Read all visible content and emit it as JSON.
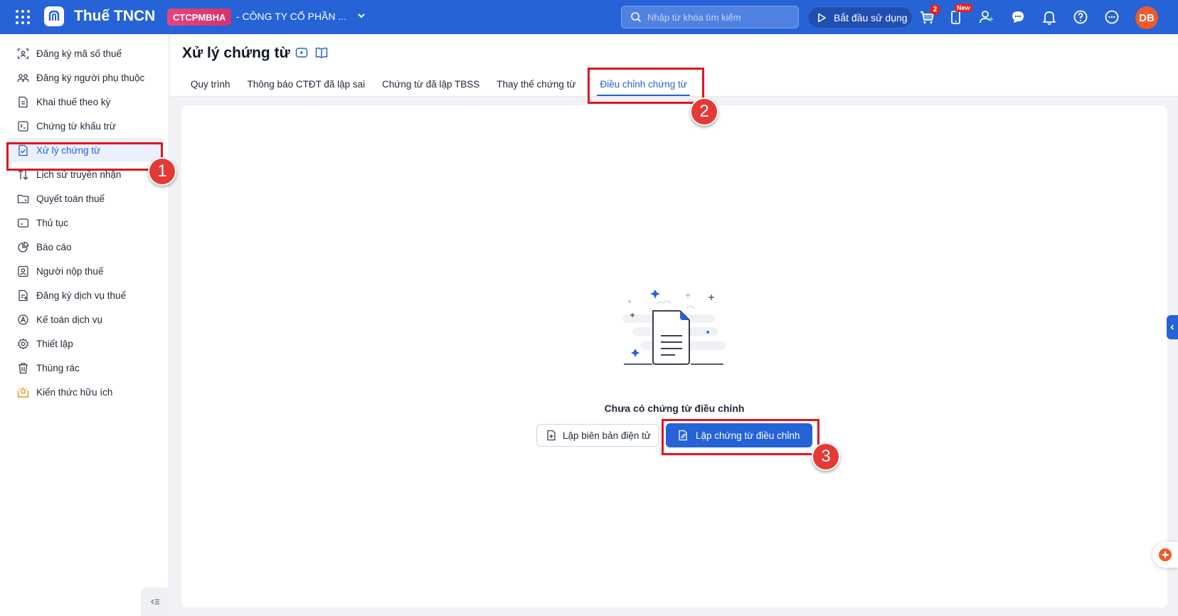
{
  "app": {
    "title": "Thuế TNCN"
  },
  "company": {
    "code": "CTCPMBHA",
    "name": "- CÔNG TY CỔ PHẦN ..."
  },
  "search": {
    "placeholder": "Nhập từ khóa tìm kiếm"
  },
  "header": {
    "start_label": "Bắt đầu sử dụng",
    "cart_badge": "2",
    "new_badge": "New",
    "avatar_initials": "DB"
  },
  "sidebar": {
    "items": [
      {
        "label": "Đăng ký mã số thuế",
        "icon": "id-card-icon"
      },
      {
        "label": "Đăng ký người phụ thuộc",
        "icon": "people-icon"
      },
      {
        "label": "Khai thuế theo kỳ",
        "icon": "document-icon"
      },
      {
        "label": "Chứng từ khấu trừ",
        "icon": "receipt-icon"
      },
      {
        "label": "Xử lý chứng từ",
        "icon": "document-check-icon",
        "active": true
      },
      {
        "label": "Lịch sử truyền nhận",
        "icon": "transfer-arrows-icon"
      },
      {
        "label": "Quyết toán thuế",
        "icon": "folder-icon"
      },
      {
        "label": "Thủ tục",
        "icon": "procedure-icon"
      },
      {
        "label": "Báo cáo",
        "icon": "pie-chart-icon"
      },
      {
        "label": "Người nộp thuế",
        "icon": "person-icon"
      },
      {
        "label": "Đăng ký dịch vụ thuế",
        "icon": "register-icon"
      },
      {
        "label": "Kế toán dịch vụ",
        "icon": "accounting-icon"
      },
      {
        "label": "Thiết lập",
        "icon": "gear-icon"
      },
      {
        "label": "Thùng rác",
        "icon": "trash-icon"
      },
      {
        "label": "Kiến thức hữu ích",
        "icon": "knowledge-icon"
      }
    ]
  },
  "page": {
    "title": "Xử lý chứng từ",
    "tabs": [
      {
        "label": "Quy trình"
      },
      {
        "label": "Thông báo CTĐT đã lập sai"
      },
      {
        "label": "Chứng từ đã lập TBSS"
      },
      {
        "label": "Thay thế chứng từ"
      },
      {
        "label": "Điều chỉnh chứng từ",
        "active": true
      }
    ],
    "empty_text": "Chưa có chứng từ điều chỉnh",
    "secondary_button": "Lập biên bản điện tử",
    "primary_button": "Lập chứng từ điều chỉnh"
  },
  "annotations": {
    "step1": "1",
    "step2": "2",
    "step3": "3"
  },
  "colors": {
    "primary": "#2563d6",
    "highlight": "#e0161f",
    "badge": "#e53935",
    "company_badge": "#e8457e"
  }
}
